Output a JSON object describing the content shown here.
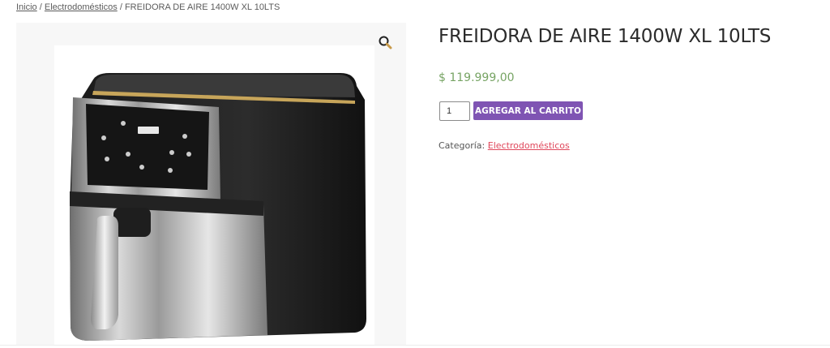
{
  "breadcrumb": {
    "home": "Inicio",
    "sep1": "/",
    "category": "Electrodomésticos",
    "sep2": "/",
    "current": "FREIDORA DE AIRE 1400W XL 10LTS"
  },
  "product": {
    "title": "FREIDORA DE AIRE 1400W XL 10LTS",
    "price": "$ 119.999,00",
    "quantity": "1",
    "add_to_cart": "AGREGAR AL CARRITO",
    "category_label": "Categoría:",
    "category_value": "Electrodomésticos"
  },
  "icons": {
    "zoom": "magnifier-icon"
  },
  "colors": {
    "accent": "#7f54b3",
    "price": "#77a464",
    "link": "#e0475b"
  }
}
